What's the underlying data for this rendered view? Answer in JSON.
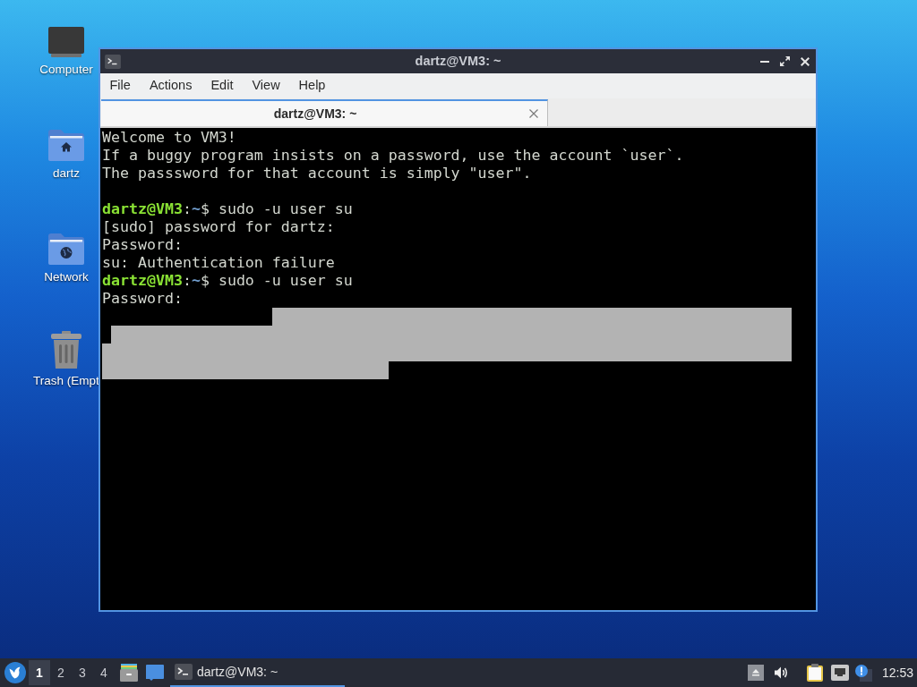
{
  "desktop_icons": [
    {
      "kind": "computer",
      "label": "Computer"
    },
    {
      "kind": "home",
      "label": "dartz"
    },
    {
      "kind": "network",
      "label": "Network"
    },
    {
      "kind": "trash",
      "label": "Trash (Empt"
    }
  ],
  "window": {
    "title": "dartz@VM3: ~",
    "menu": [
      "File",
      "Actions",
      "Edit",
      "View",
      "Help"
    ],
    "tabs": [
      {
        "label": "dartz@VM3: ~",
        "selected": true
      }
    ]
  },
  "terminal": {
    "lines": [
      {
        "kind": "output",
        "text": "Welcome to VM3!"
      },
      {
        "kind": "output",
        "text": "If a buggy program insists on a password, use the account `user`."
      },
      {
        "kind": "output",
        "text": "The passsword for that account is simply \"user\"."
      },
      {
        "kind": "blank"
      },
      {
        "kind": "prompt",
        "user_host": "dartz@VM3",
        "separator": ":",
        "path": "~",
        "command": "$ sudo -u user su"
      },
      {
        "kind": "output",
        "text": "[sudo] password for dartz:"
      },
      {
        "kind": "output",
        "text": "Password:"
      },
      {
        "kind": "output",
        "text": "su: Authentication failure"
      },
      {
        "kind": "prompt",
        "user_host": "dartz@VM3",
        "separator": ":",
        "path": "~",
        "command": "$ sudo -u user su"
      },
      {
        "kind": "output",
        "text": "Password:"
      }
    ],
    "selection": true
  },
  "taskbar": {
    "workspaces": [
      {
        "label": "1",
        "selected": true
      },
      {
        "label": "2",
        "selected": false
      },
      {
        "label": "3",
        "selected": false
      },
      {
        "label": "4",
        "selected": false
      }
    ],
    "tasks": [
      {
        "label": "dartz@VM3: ~",
        "selected": true
      }
    ],
    "clock": "12:53"
  }
}
